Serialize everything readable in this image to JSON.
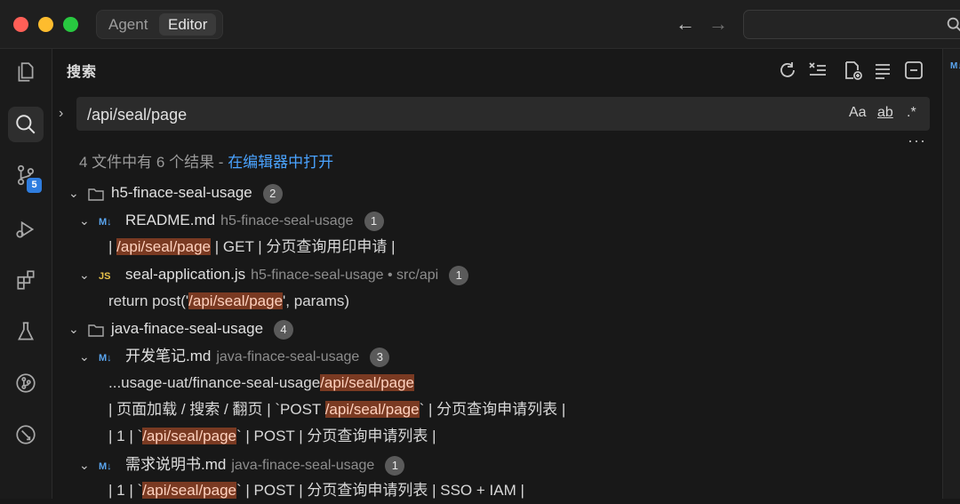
{
  "titlebar": {
    "tabs": [
      "Agent",
      "Editor"
    ],
    "active_tab": "Editor"
  },
  "activity": {
    "source_control_badge": "5"
  },
  "panel": {
    "title": "搜索",
    "query": "/api/seal/page",
    "toggles": {
      "match_case": "Aa",
      "whole_word": "ab",
      "regex": ".*"
    },
    "more": "···",
    "summary_prefix": "4 文件中有 6 个结果 - ",
    "summary_link": "在编辑器中打开"
  },
  "results": {
    "g1": {
      "folder": "h5-finace-seal-usage",
      "count": "2",
      "f1": {
        "icon": "M↓",
        "name": "README.md",
        "path": "h5-finace-seal-usage",
        "count": "1",
        "m1": {
          "pre": "| ",
          "hit": "/api/seal/page",
          "post": " | GET | 分页查询用印申请 |"
        }
      },
      "f2": {
        "icon": "JS",
        "name": "seal-application.js",
        "path": "h5-finace-seal-usage • src/api",
        "count": "1",
        "m1": {
          "pre": "return post('",
          "hit": "/api/seal/page",
          "post": "', params)"
        }
      }
    },
    "g2": {
      "folder": "java-finace-seal-usage",
      "count": "4",
      "f1": {
        "icon": "M↓",
        "name": "开发笔记.md",
        "path": "java-finace-seal-usage",
        "count": "3",
        "m1": {
          "pre": "...usage-uat/finance-seal-usage",
          "hit": "/api/seal/page",
          "post": ""
        },
        "m2": {
          "pre": "| 页面加载 / 搜索 / 翻页 | `POST ",
          "hit": "/api/seal/page",
          "post": "` | 分页查询申请列表 |"
        },
        "m3": {
          "pre": "| 1 | `",
          "hit": "/api/seal/page",
          "post": "` | POST | 分页查询申请列表 |"
        }
      },
      "f2": {
        "icon": "M↓",
        "name": "需求说明书.md",
        "path": "java-finace-seal-usage",
        "count": "1",
        "m1": {
          "pre": "| 1 | `",
          "hit": "/api/seal/page",
          "post": "` | POST | 分页查询申请列表 | SSO + IAM |"
        }
      }
    }
  },
  "editor_tab_icon": "M↓",
  "colors": {
    "highlight": "#7a3a22",
    "link": "#4aa3ff",
    "badge": "#2f7ddf"
  }
}
